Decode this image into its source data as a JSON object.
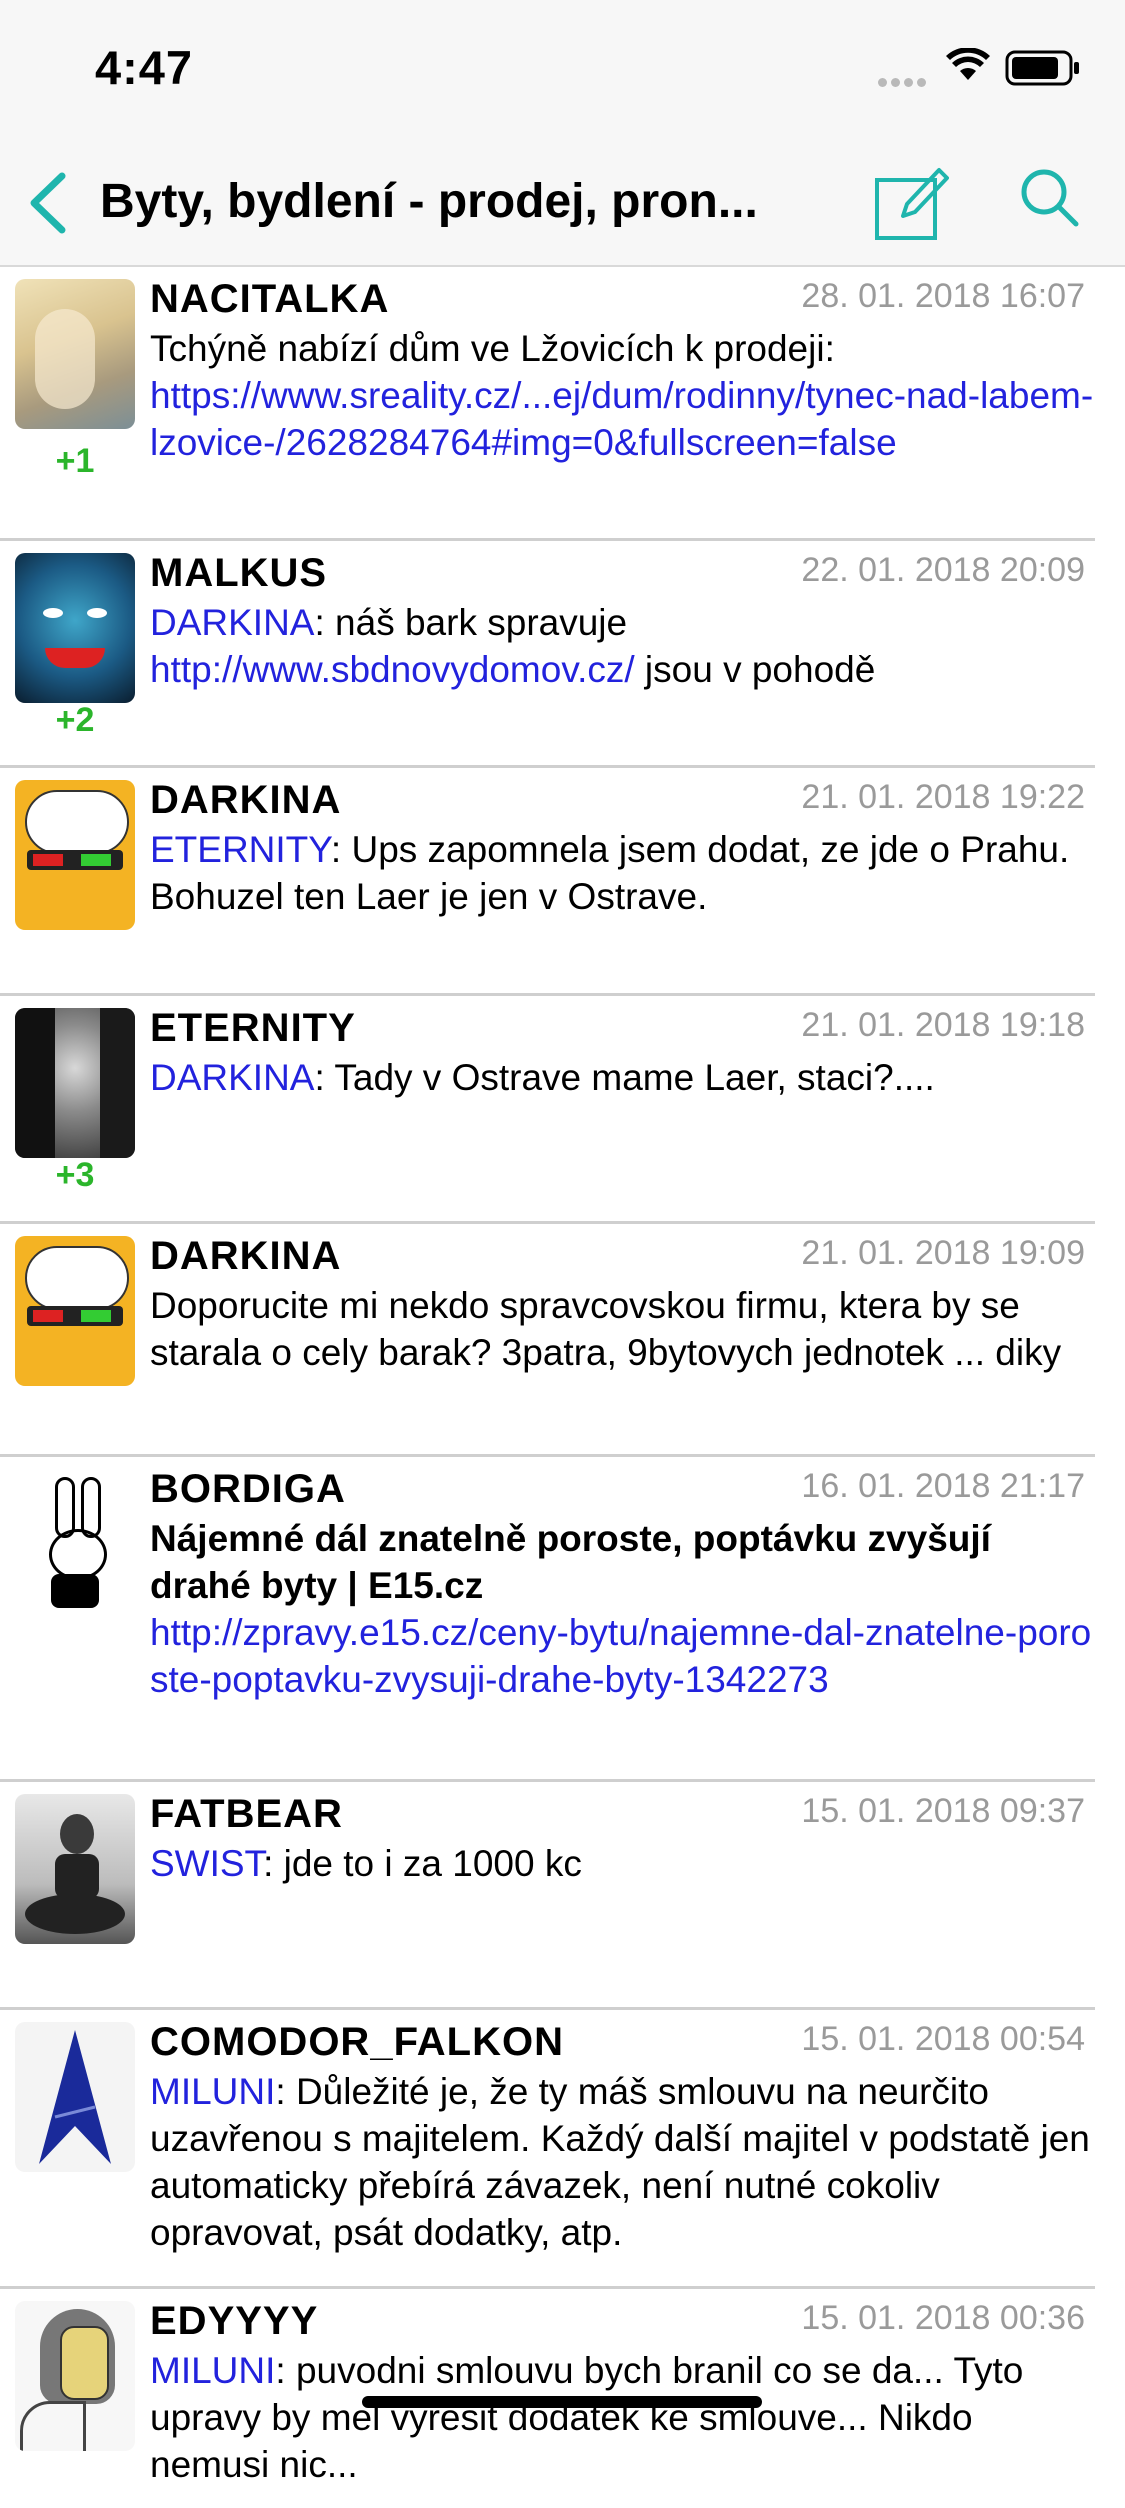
{
  "status": {
    "time": "4:47"
  },
  "nav": {
    "title": "Byty, bydlení - prodej, pron...",
    "accent": "#1fb5ad"
  },
  "posts": [
    {
      "author": "NACITALKA",
      "date": "28. 01. 2018 16:07",
      "votes": "+1",
      "text": "Tchýně nabízí dům ve Lžovicích k prodeji:",
      "link": "https://www.sreality.cz/...ej/dum/rodinny/tynec-nad-labem-lzovice-/2628284764#img=0&fullscreen=false"
    },
    {
      "author": "MALKUS",
      "date": "22. 01. 2018 20:09",
      "votes": "+2",
      "mention": "DARKINA",
      "text1": ": náš bark spravuje ",
      "link": "http://www.sbdnovydomov.cz/",
      "text2": " jsou v pohodě"
    },
    {
      "author": "DARKINA",
      "date": "21. 01. 2018 19:22",
      "mention": "ETERNITY",
      "text": ": Ups zapomnela jsem dodat, ze jde o Prahu. Bohuzel ten Laer je jen v Ostrave."
    },
    {
      "author": "ETERNITY",
      "date": "21. 01. 2018 19:18",
      "votes": "+3",
      "mention": "DARKINA",
      "text": ": Tady v Ostrave mame Laer, staci?...."
    },
    {
      "author": "DARKINA",
      "date": "21. 01. 2018 19:09",
      "text": "Doporucite mi nekdo spravcovskou firmu, ktera by se starala o cely barak? 3patra, 9bytovych jednotek ... diky"
    },
    {
      "author": "BORDIGA",
      "date": "16. 01. 2018 21:17",
      "headline": "Nájemné dál znatelně poroste, poptávku zvyšují drahé byty | E15.cz",
      "link": "http://zpravy.e15.cz/ceny-bytu/najemne-dal-znatelne-poroste-poptavku-zvysuji-drahe-byty-1342273"
    },
    {
      "author": "FATBEAR",
      "date": "15. 01. 2018 09:37",
      "mention": "SWIST",
      "text": ": jde to i za 1000 kc"
    },
    {
      "author": "COMODOR_FALKON",
      "date": "15. 01. 2018 00:54",
      "mention": "MILUNI",
      "text": ": Důležité je, že ty máš smlouvu na neurčito uzavřenou s majitelem. Každý další majitel v podstatě jen automaticky přebírá závazek, není nutné cokoliv opravovat, psát dodatky, atp."
    },
    {
      "author": "EDYYYY",
      "date": "15. 01. 2018 00:36",
      "mention": "MILUNI",
      "text": ": puvodni smlouvu bych branil co se da... Tyto upravy by mel vyresit dodatek ke smlouve... Nikdo nemusi nic..."
    }
  ]
}
